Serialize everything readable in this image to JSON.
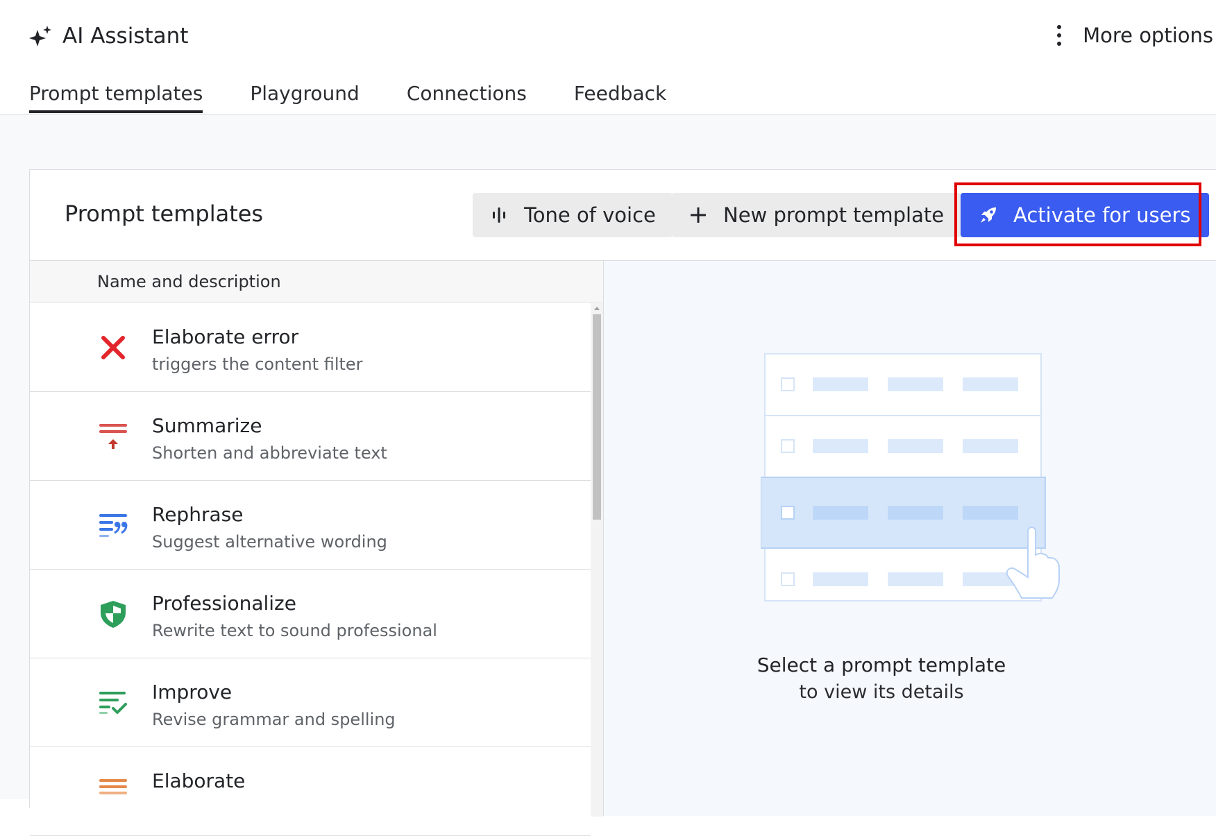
{
  "app": {
    "title": "AI Assistant",
    "more_options": "More options"
  },
  "tabs": [
    {
      "label": "Prompt templates",
      "active": true
    },
    {
      "label": "Playground",
      "active": false
    },
    {
      "label": "Connections",
      "active": false
    },
    {
      "label": "Feedback",
      "active": false
    }
  ],
  "panel": {
    "title": "Prompt templates",
    "buttons": {
      "tone": "Tone of voice",
      "new_template": "New prompt template",
      "activate": "Activate for users"
    }
  },
  "list": {
    "column_header": "Name and description",
    "items": [
      {
        "name": "Elaborate error",
        "description": "triggers the content filter",
        "icon": "error-x-icon"
      },
      {
        "name": "Summarize",
        "description": "Shorten and abbreviate text",
        "icon": "summarize-icon"
      },
      {
        "name": "Rephrase",
        "description": "Suggest alternative wording",
        "icon": "rephrase-quote-icon"
      },
      {
        "name": "Professionalize",
        "description": "Rewrite text to sound professional",
        "icon": "shield-icon"
      },
      {
        "name": "Improve",
        "description": "Revise grammar and spelling",
        "icon": "improve-check-icon"
      },
      {
        "name": "Elaborate",
        "description": "",
        "icon": "elaborate-icon"
      }
    ]
  },
  "empty_state": {
    "title": "Select a prompt template",
    "subtitle": "to view its details"
  },
  "colors": {
    "primary": "#3a5cf0",
    "highlight": "#e00000",
    "error": "#e3262b",
    "summarize": "#d9534f",
    "rephrase": "#3b76e6",
    "shield": "#2e9e5b",
    "improve": "#2e9e5b",
    "elaborate": "#e5894a"
  }
}
